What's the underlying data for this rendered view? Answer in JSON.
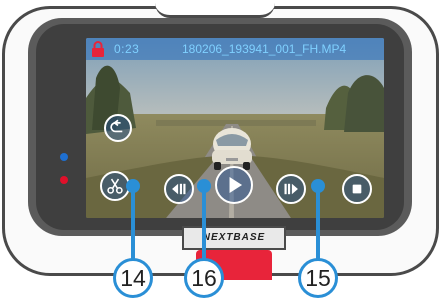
{
  "screen": {
    "time": "0:23",
    "filename": "180206_193941_001_FH.MP4"
  },
  "controls": {
    "back": "back-arrow-icon",
    "cut": "scissors-icon",
    "rewind": "step-back-icon",
    "play": "play-icon",
    "forward": "step-forward-icon",
    "stop": "stop-icon"
  },
  "brand": {
    "logo": "NEXTBASE"
  },
  "callouts": [
    {
      "number": "14"
    },
    {
      "number": "16"
    },
    {
      "number": "15"
    }
  ],
  "colors": {
    "accent": "#2a8fd6",
    "status_text": "#7fd0ff",
    "lock": "#e8243a",
    "red_button": "#e8243a",
    "led_blue": "#1e6fd0",
    "led_red": "#e0102a"
  }
}
